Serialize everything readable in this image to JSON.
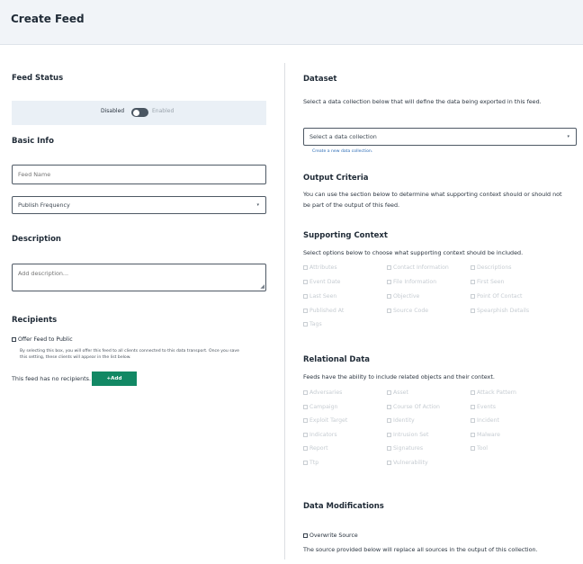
{
  "header": {
    "title": "Create Feed"
  },
  "feed_status": {
    "title": "Feed Status",
    "disabled_label": "Disabled",
    "enabled_label": "Enabled"
  },
  "basic_info": {
    "title": "Basic Info",
    "feed_name_placeholder": "Feed Name",
    "publish_frequency_placeholder": "Publish Frequency"
  },
  "description": {
    "title": "Description",
    "placeholder": "Add description..."
  },
  "recipients": {
    "title": "Recipients",
    "offer_public_label": "Offer Feed to Public",
    "offer_public_help_1": "By selecting this box, you will offer this feed to all clients connected to this data transport. Once you save",
    "offer_public_help_2": "this setting, these clients will appear in the list below.",
    "no_recipients_text": "This feed has no recipients.",
    "add_button_label": "+Add"
  },
  "dataset": {
    "title": "Dataset",
    "help": "Select a data collection below that will define the data being exported in this feed.",
    "select_placeholder": "Select a data collection",
    "create_link": "Create a new data collection."
  },
  "output_criteria": {
    "title": "Output Criteria",
    "help_1": "You can use the section below to determine what supporting context should or should not",
    "help_2": "be part of the output of this feed."
  },
  "supporting_context": {
    "title": "Supporting Context",
    "help": "Select options below to choose what supporting context should be included.",
    "options": [
      "Attributes",
      "Contact Information",
      "Descriptions",
      "Event Date",
      "File Information",
      "First Seen",
      "Last Seen",
      "Objective",
      "Point Of Contact",
      "Published At",
      "Source Code",
      "Spearphish Details",
      "Tags"
    ]
  },
  "relational_data": {
    "title": "Relational Data",
    "help": "Feeds have the ability to include related objects and their context.",
    "options": [
      "Adversaries",
      "Asset",
      "Attack Pattern",
      "Campaign",
      "Course Of Action",
      "Events",
      "Exploit Target",
      "Identity",
      "Incident",
      "Indicators",
      "Intrusion Set",
      "Malware",
      "Report",
      "Signatures",
      "Tool",
      "Ttp",
      "Vulnerability"
    ]
  },
  "data_modifications": {
    "title": "Data Modifications",
    "overwrite_label": "Overwrite Source",
    "help": "The source provided below will replace all sources in the output of this collection."
  }
}
